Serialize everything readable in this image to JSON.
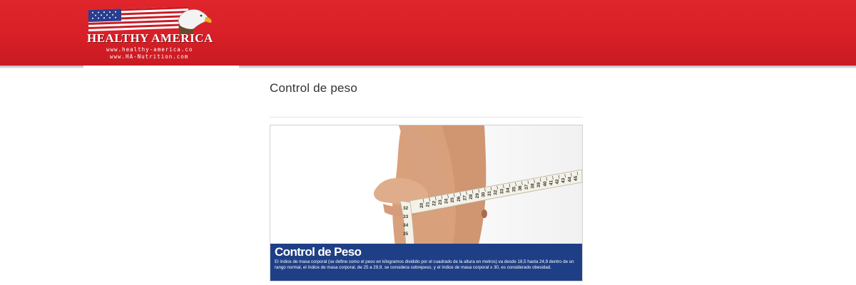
{
  "header": {
    "logo": {
      "name": "HEALTHY AMERICA",
      "url_primary": "www.healthy-america.co",
      "url_secondary": "www.HA-Nutrition.com"
    },
    "colors": {
      "header_red": "#d81f27",
      "banner_blue": "#1e3f86"
    }
  },
  "main": {
    "page_title": "Control de peso",
    "banner": {
      "title": "Control de Peso",
      "text": "El índice de masa corporal (se define como el peso en kilogramos dividido por el cuadrado de la altura en metros) va desde 18,5 hasta 24,9 dentro de un rango normal, el índice de masa corporal, de 25 a 29,9, se considera sobrepeso, y el índice de masa corporal ≥ 30, es considerado obesidad.",
      "tape_numbers": [
        "20",
        "21",
        "22",
        "23",
        "24",
        "25",
        "26",
        "27",
        "28",
        "29",
        "30",
        "31",
        "32",
        "33",
        "34",
        "35",
        "36",
        "37",
        "38",
        "39",
        "40",
        "41",
        "42",
        "43",
        "44",
        "45"
      ],
      "image": "tape-measure-waist-image"
    }
  }
}
